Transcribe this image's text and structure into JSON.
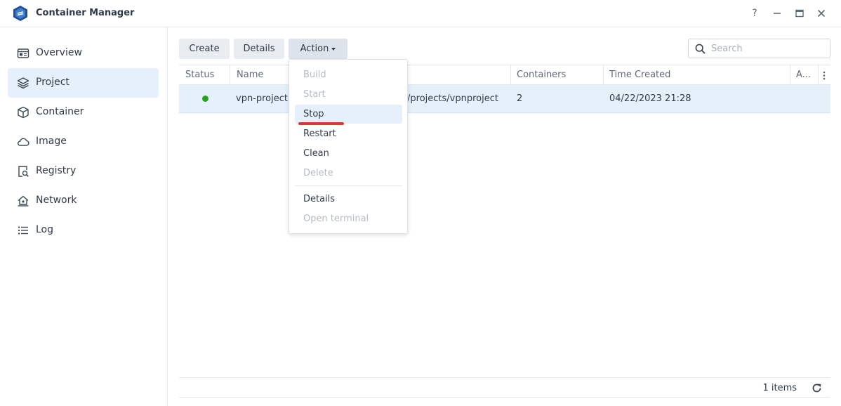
{
  "window": {
    "title": "Container Manager",
    "help_symbol": "?"
  },
  "sidebar": {
    "items": [
      {
        "label": "Overview",
        "icon": "overview-icon",
        "active": false
      },
      {
        "label": "Project",
        "icon": "layers-icon",
        "active": true
      },
      {
        "label": "Container",
        "icon": "cube-icon",
        "active": false
      },
      {
        "label": "Image",
        "icon": "cloud-icon",
        "active": false
      },
      {
        "label": "Registry",
        "icon": "registry-search-icon",
        "active": false
      },
      {
        "label": "Network",
        "icon": "network-home-icon",
        "active": false
      },
      {
        "label": "Log",
        "icon": "list-icon",
        "active": false
      }
    ]
  },
  "toolbar": {
    "create_label": "Create",
    "details_label": "Details",
    "action_label": "Action",
    "search_placeholder": "Search"
  },
  "table": {
    "columns": [
      "Status",
      "Name",
      "Containers",
      "Time Created",
      "A..."
    ],
    "rows": [
      {
        "status": "running",
        "name": "vpn-project",
        "path": "/projects/vpnproject",
        "containers": "2",
        "time_created": "04/22/2023 21:28"
      }
    ]
  },
  "action_menu": {
    "items": [
      {
        "label": "Build",
        "enabled": false
      },
      {
        "label": "Start",
        "enabled": false
      },
      {
        "label": "Stop",
        "enabled": true,
        "highlighted": true
      },
      {
        "label": "Restart",
        "enabled": true
      },
      {
        "label": "Clean",
        "enabled": true
      },
      {
        "label": "Delete",
        "enabled": false
      },
      {
        "label": "Details",
        "enabled": true
      },
      {
        "label": "Open terminal",
        "enabled": false
      }
    ]
  },
  "footer": {
    "items_count": "1 items"
  },
  "colors": {
    "accent_bg": "#e6f0fb",
    "status_running": "#26a51c",
    "annotation_red": "#d63a32"
  }
}
